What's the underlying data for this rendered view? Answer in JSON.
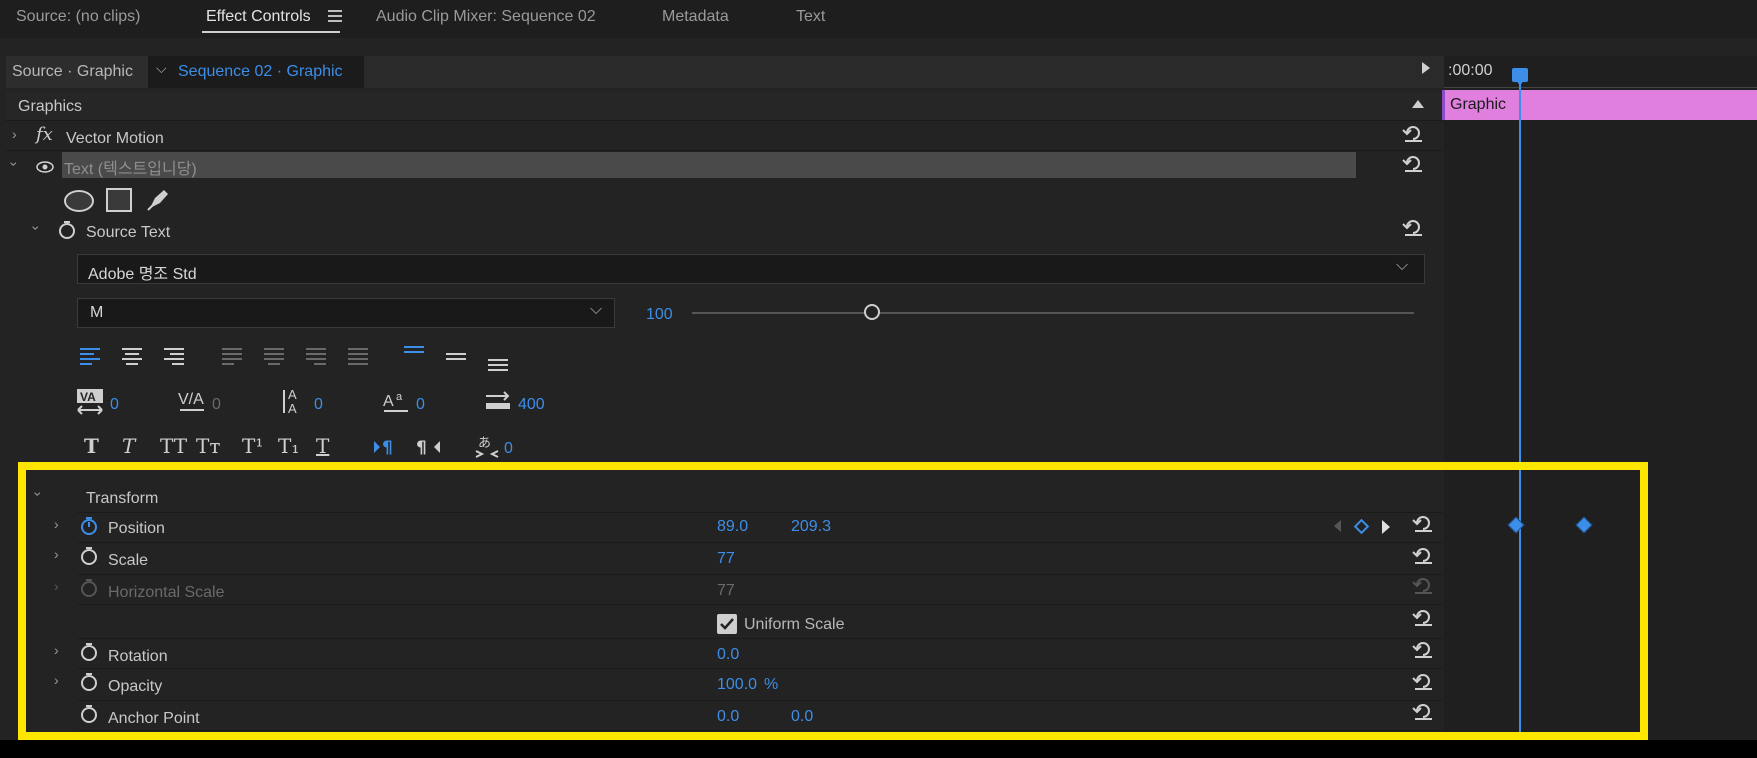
{
  "tabs": [
    {
      "label": "Source: (no clips)"
    },
    {
      "label": "Effect Controls",
      "active": true
    },
    {
      "label": "Audio Clip Mixer: Sequence 02"
    },
    {
      "label": "Metadata"
    },
    {
      "label": "Text"
    }
  ],
  "tab_menu_icon": "hamburger-menu-icon",
  "subheader": {
    "source": "Source · Graphic",
    "sequence": "Sequence 02 · Graphic"
  },
  "timeline": {
    "timecode": ":00:00",
    "clip_label": "Graphic",
    "clip_color": "#e07fde",
    "playhead_color": "#3d8ee8"
  },
  "section_title": "Graphics",
  "vector_motion": {
    "label": "Vector Motion",
    "fx": "fx"
  },
  "text_layer": {
    "label": "Text (텍스트입니당)"
  },
  "source_text": {
    "label": "Source Text"
  },
  "font": {
    "family": "Adobe 명조 Std",
    "style": "M",
    "size": "100"
  },
  "metrics": {
    "kerning": "0",
    "tracking": "0",
    "leading": "0",
    "baseline_shift": "0",
    "tab_width": "400",
    "tsume": "0"
  },
  "format_buttons": {
    "bold": "T",
    "italic": "T",
    "all_caps": "TT",
    "small_caps": "Tт",
    "superscript": "T¹",
    "subscript": "T₁",
    "underline": "T"
  },
  "transform": {
    "label": "Transform",
    "position": {
      "label": "Position",
      "x": "89.0",
      "y": "209.3"
    },
    "scale": {
      "label": "Scale",
      "value": "77"
    },
    "horizontal_scale": {
      "label": "Horizontal Scale",
      "value": "77"
    },
    "uniform_scale": {
      "label": "Uniform Scale",
      "checked": true
    },
    "rotation": {
      "label": "Rotation",
      "value": "0.0"
    },
    "opacity": {
      "label": "Opacity",
      "value": "100.0",
      "unit": "%"
    },
    "anchor_point": {
      "label": "Anchor Point",
      "x": "0.0",
      "y": "0.0"
    }
  },
  "colors": {
    "accent": "#3d8ee8",
    "highlight": "#ffe600",
    "background": "#232323"
  }
}
